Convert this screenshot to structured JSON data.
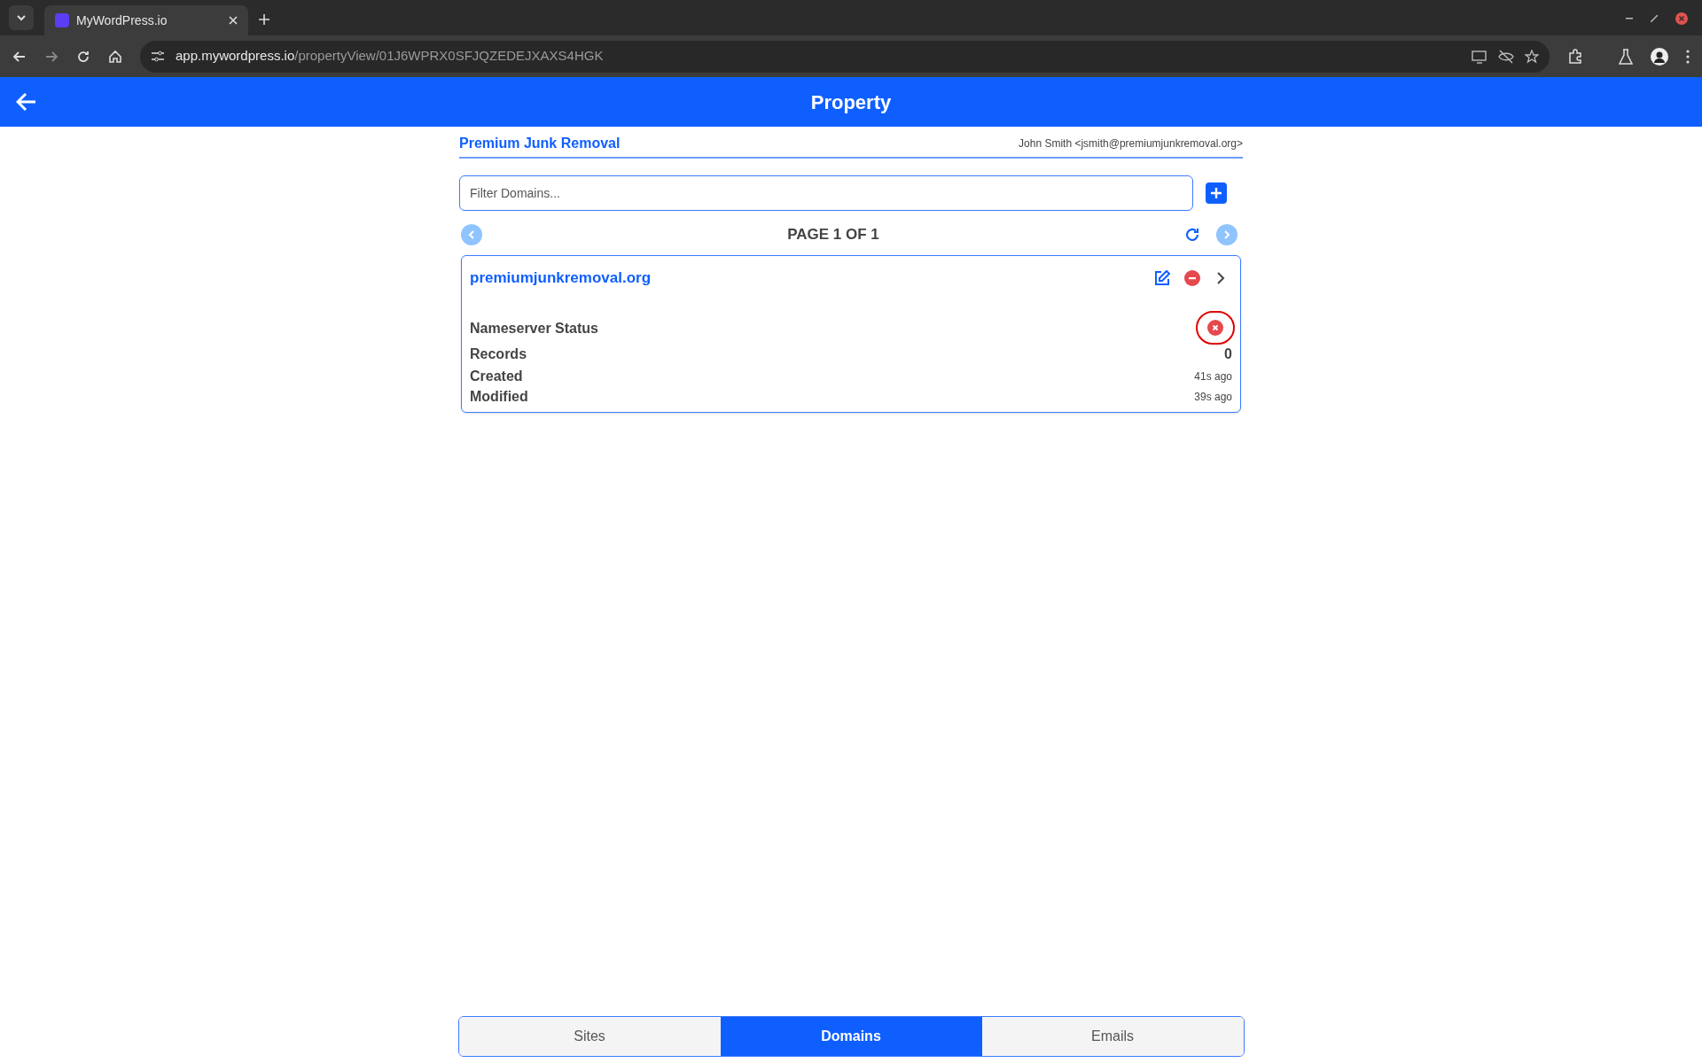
{
  "browser": {
    "tab_title": "MyWordPress.io",
    "url_host": "app.mywordpress.io",
    "url_path": "/propertyView/01J6WPRX0SFJQZEDEJXAXS4HGK"
  },
  "header": {
    "title": "Property"
  },
  "property": {
    "name": "Premium Junk Removal",
    "owner": "John Smith <jsmith@premiumjunkremoval.org>"
  },
  "filter": {
    "placeholder": "Filter Domains..."
  },
  "pagination": {
    "label": "PAGE 1 OF 1"
  },
  "domains": [
    {
      "name": "premiumjunkremoval.org",
      "highlighted": true,
      "fields": [
        {
          "kind": "status",
          "label": "Nameserver Status",
          "ok": false
        },
        {
          "kind": "count",
          "label": "Records",
          "value": "0"
        },
        {
          "kind": "time",
          "label": "Created",
          "value": "41s ago"
        },
        {
          "kind": "time",
          "label": "Modified",
          "value": "39s ago"
        }
      ]
    }
  ],
  "bottom_tabs": [
    {
      "label": "Sites",
      "selected": false
    },
    {
      "label": "Domains",
      "selected": true
    },
    {
      "label": "Emails",
      "selected": false
    }
  ]
}
